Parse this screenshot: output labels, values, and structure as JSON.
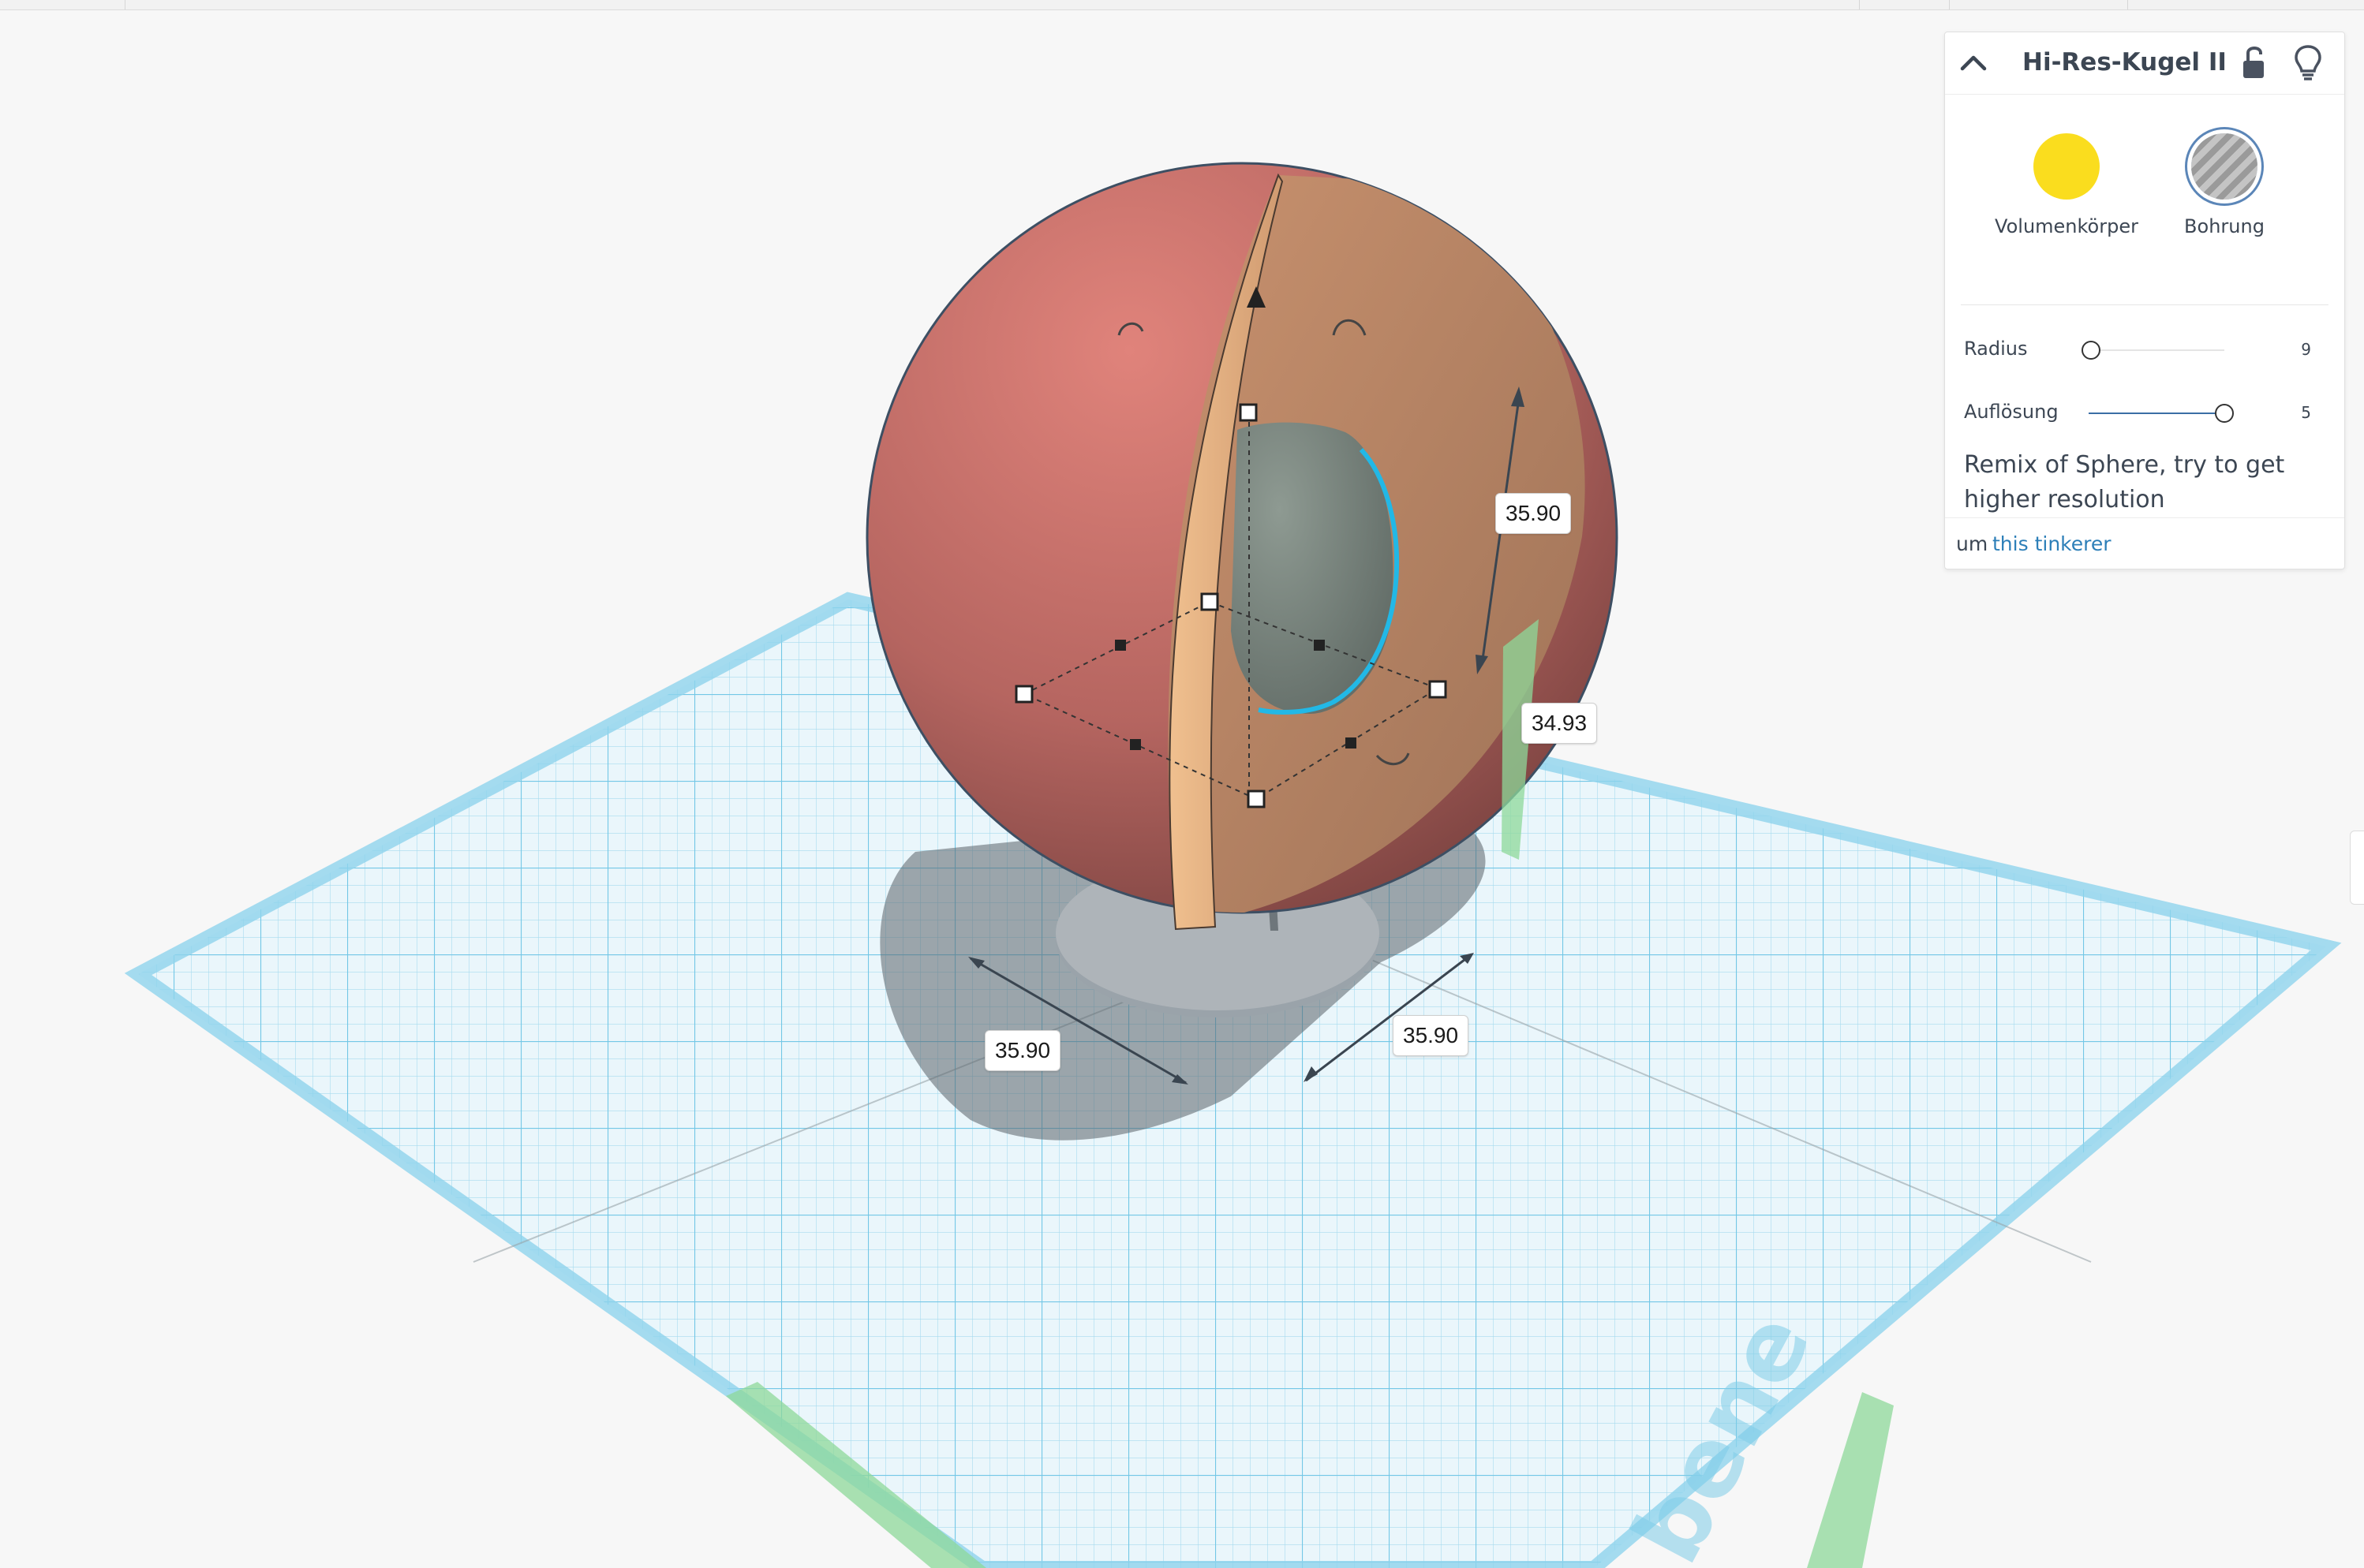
{
  "inspector": {
    "title": "Hi-Res-Kugel II",
    "solid_label": "Volumenkörper",
    "hole_label": "Bohrung",
    "solid_color": "#fadd1e",
    "params": [
      {
        "label": "Radius",
        "value": "9",
        "fraction": 0.02
      },
      {
        "label": "Auflösung",
        "value": "5",
        "fraction": 1.0
      }
    ],
    "description": "Remix of Sphere, try to get higher resolution",
    "author_prefix": "um",
    "author_link": "this tinkerer"
  },
  "viewport": {
    "dimensions": {
      "height": "35.90",
      "elevation": "34.93",
      "width": "35.90",
      "depth": "35.90"
    },
    "grid_color": "#8fd3ec",
    "sphere_color": "#c5736a",
    "cut_face_color": "#d9a47c",
    "selection_color": "#22b8e6"
  },
  "icons": [
    "chevron-up-icon",
    "lock-icon",
    "lightbulb-icon",
    "rotate-arrow-icon",
    "cone-handle-icon",
    "side-handle-icon"
  ]
}
